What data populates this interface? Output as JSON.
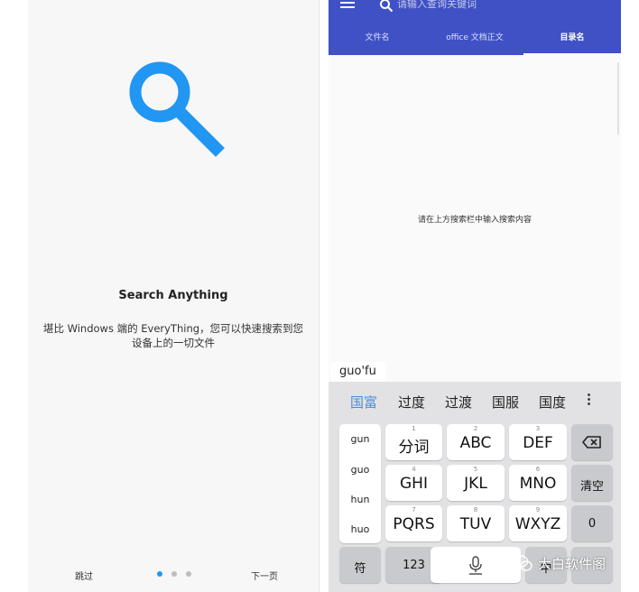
{
  "onboarding": {
    "title": "Search Anything",
    "description": "堪比 Windows 端的 EveryThing，您可以快速搜索到您设备上的一切文件",
    "skip_label": "跳过",
    "next_label": "下一页",
    "page_indicator": {
      "total": 3,
      "active": 1
    },
    "accent_color": "#2196F3",
    "icon": "search-icon"
  },
  "search_screen": {
    "search_placeholder": "请输入查询关键词",
    "tabs": [
      {
        "label": "文件名",
        "active": false
      },
      {
        "label": "office 文档正文",
        "active": false
      },
      {
        "label": "目录名",
        "active": true
      }
    ],
    "empty_hint": "请在上方搜索栏中输入搜索内容",
    "appbar_color": "#3f51c5"
  },
  "keyboard": {
    "composing_text": "guo'fu",
    "candidates": [
      "国富",
      "过度",
      "过渡",
      "国服",
      "国度"
    ],
    "pinyin_options": [
      "gun",
      "guo",
      "hun",
      "huo"
    ],
    "rows": [
      [
        {
          "num": "1",
          "label": "分词"
        },
        {
          "num": "2",
          "label": "ABC"
        },
        {
          "num": "3",
          "label": "DEF"
        }
      ],
      [
        {
          "num": "4",
          "label": "GHI"
        },
        {
          "num": "5",
          "label": "JKL"
        },
        {
          "num": "6",
          "label": "MNO"
        }
      ],
      [
        {
          "num": "7",
          "label": "PQRS"
        },
        {
          "num": "8",
          "label": "TUV"
        },
        {
          "num": "9",
          "label": "WXYZ"
        }
      ]
    ],
    "clear_label": "清空",
    "zero_label": "0",
    "symbol_label": "符",
    "numeric_label": "123",
    "lang_label": "中",
    "backspace_icon": "backspace-icon",
    "mic_icon": "mic-icon"
  },
  "watermark": "大白软件阁"
}
